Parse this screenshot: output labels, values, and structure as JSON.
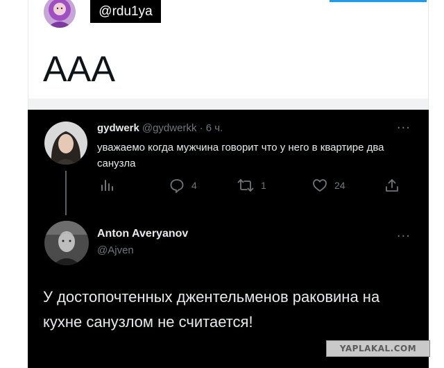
{
  "top_tweet": {
    "handle": "@rdu1ya",
    "text": "AAA"
  },
  "quoted_tweet": {
    "name": "gydwerk",
    "meta": "@gydwerkk · 6 ч.",
    "text": "уважаемо когда мужчина говорит что у него в квартире два санузла",
    "more_icon": "more-dots-icon",
    "actions": {
      "stats_icon": "analytics-icon",
      "reply_icon": "reply-icon",
      "reply_count": "4",
      "retweet_icon": "retweet-icon",
      "retweet_count": "1",
      "like_icon": "like-heart-icon",
      "like_count": "24",
      "share_icon": "share-icon"
    }
  },
  "reply_tweet": {
    "name": "Anton Averyanov",
    "handle": "@Ajven",
    "text": "У достопочтенных джентельменов раковина на кухне санузлом не считается!",
    "more_icon": "more-dots-icon"
  },
  "watermark": "YAPLAKAL.COM",
  "colors": {
    "dark_bg": "#000000",
    "text_primary": "#e7e9ea",
    "text_secondary": "#71767b",
    "accent": "#1d9bf0"
  }
}
